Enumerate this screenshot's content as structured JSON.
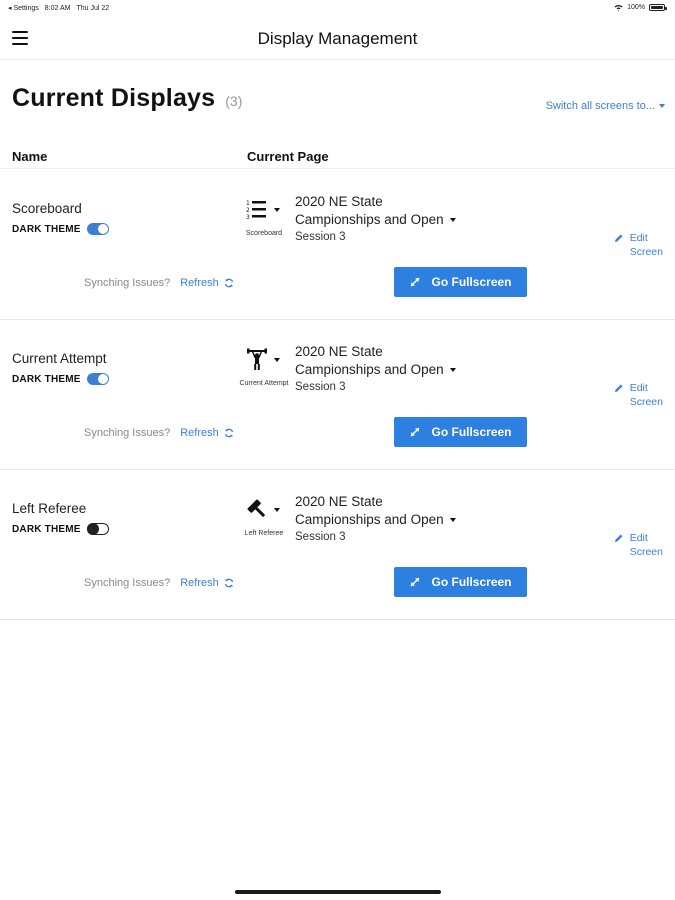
{
  "status_bar": {
    "back_label": "◂ Settings",
    "time": "8:02 AM",
    "date": "Thu Jul 22",
    "battery": "100%"
  },
  "nav": {
    "title": "Display Management"
  },
  "heading": {
    "title": "Current Displays",
    "count": "(3)",
    "switch_all": "Switch all screens to..."
  },
  "columns": {
    "name": "Name",
    "current_page": "Current Page"
  },
  "displays": [
    {
      "name": "Scoreboard",
      "theme_label": "DARK THEME",
      "dark_theme": true,
      "page_icon": "scoreboard-list-icon",
      "page_icon_label": "Scoreboard",
      "competition_line1": "2020 NE State",
      "competition_line2": "Campionships and Open",
      "session": "Session 3",
      "edit_line1": "Edit",
      "edit_line2": "Screen",
      "sync_question": "Synching Issues?",
      "refresh_label": "Refresh",
      "fullscreen_label": "Go Fullscreen"
    },
    {
      "name": "Current Attempt",
      "theme_label": "DARK THEME",
      "dark_theme": true,
      "page_icon": "lifter-icon",
      "page_icon_label": "Current Attempt",
      "competition_line1": "2020 NE State",
      "competition_line2": "Campionships and Open",
      "session": "Session 3",
      "edit_line1": "Edit",
      "edit_line2": "Screen",
      "sync_question": "Synching Issues?",
      "refresh_label": "Refresh",
      "fullscreen_label": "Go Fullscreen"
    },
    {
      "name": "Left Referee",
      "theme_label": "DARK THEME",
      "dark_theme": false,
      "page_icon": "gavel-icon",
      "page_icon_label": "Left Referee",
      "competition_line1": "2020 NE State",
      "competition_line2": "Campionships and Open",
      "session": "Session 3",
      "edit_line1": "Edit",
      "edit_line2": "Screen",
      "sync_question": "Synching Issues?",
      "refresh_label": "Refresh",
      "fullscreen_label": "Go Fullscreen"
    }
  ],
  "colors": {
    "accent": "#3b7fd6",
    "button": "#2d7fe0"
  }
}
